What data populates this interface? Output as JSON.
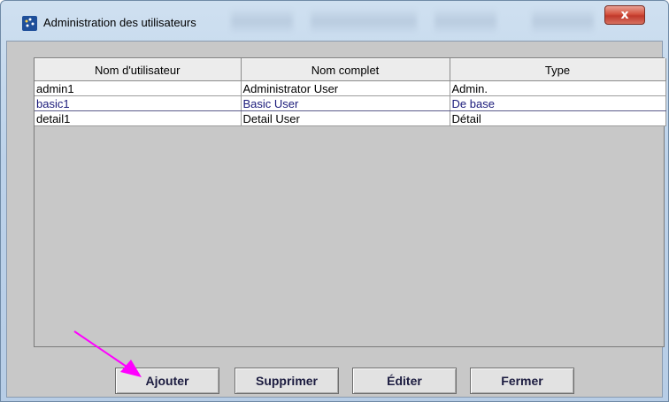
{
  "window": {
    "title": "Administration des utilisateurs",
    "close_glyph": "x"
  },
  "table": {
    "columns": [
      "Nom d'utilisateur",
      "Nom complet",
      "Type"
    ],
    "rows": [
      {
        "username": "admin1",
        "fullname": "Administrator User",
        "type": "Admin."
      },
      {
        "username": "basic1",
        "fullname": "Basic User",
        "type": "De base",
        "selected": true
      },
      {
        "username": "detail1",
        "fullname": "Detail User",
        "type": "Détail"
      }
    ]
  },
  "buttons": {
    "add": "Ajouter",
    "delete": "Supprimer",
    "edit": "Éditer",
    "close": "Fermer"
  },
  "icons": {
    "app": "app-icon",
    "close": "close-icon",
    "pointer": "arrow-pointer-icon"
  },
  "colors": {
    "annotation_arrow": "#ff00ff",
    "selected_text": "#1a1a7a"
  }
}
